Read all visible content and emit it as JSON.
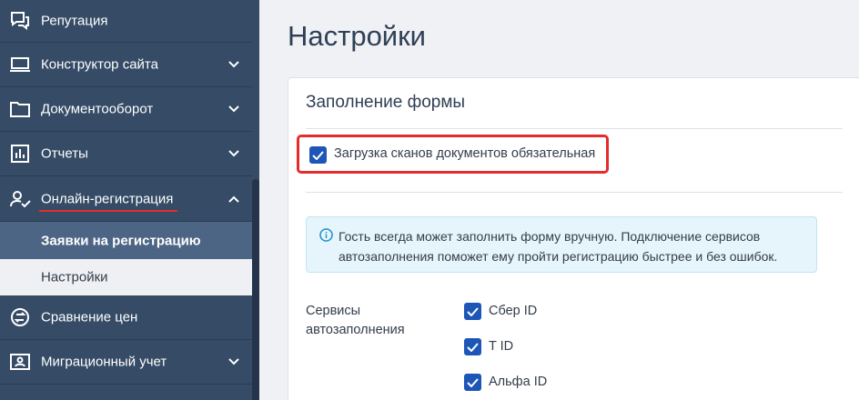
{
  "sidebar": {
    "items": [
      {
        "label": "Репутация",
        "icon": "chat-icon"
      },
      {
        "label": "Конструктор сайта",
        "icon": "laptop-icon"
      },
      {
        "label": "Документооборот",
        "icon": "folder-icon"
      },
      {
        "label": "Отчеты",
        "icon": "bar-chart-icon"
      },
      {
        "label": "Онлайн-регистрация",
        "icon": "user-check-icon"
      },
      {
        "label": "Сравнение цен",
        "icon": "compare-icon"
      },
      {
        "label": "Миграционный учет",
        "icon": "id-card-icon"
      }
    ],
    "sub_items": [
      {
        "label": "Заявки на регистрацию"
      },
      {
        "label": "Настройки"
      }
    ]
  },
  "main": {
    "title": "Настройки",
    "card_title": "Заполнение формы",
    "required_scans_label": "Загрузка сканов документов обязательная",
    "info_text": "Гость всегда может заполнить форму вручную. Подключение сервисов автозаполнения поможет ему пройти регистрацию быстрее и без ошибок.",
    "services_label": "Сервисы автозаполнения",
    "services": [
      {
        "label": "Сбер ID",
        "checked": true
      },
      {
        "label": "T ID",
        "checked": true
      },
      {
        "label": "Альфа ID",
        "checked": true
      }
    ]
  },
  "colors": {
    "sidebar_bg": "#354b66",
    "sidebar_active": "#4d6584",
    "accent": "#1e56b8",
    "highlight": "#e52b2b"
  }
}
